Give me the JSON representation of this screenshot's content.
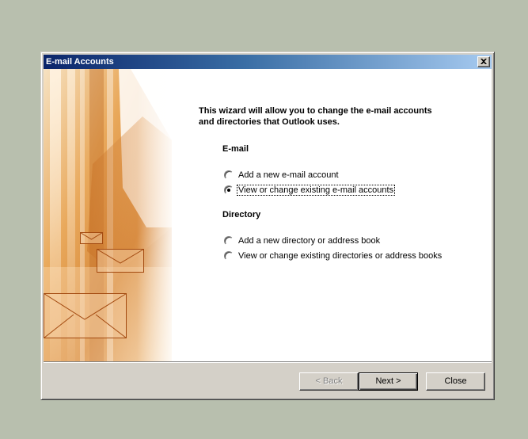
{
  "window": {
    "title": "E-mail Accounts",
    "close_glyph": "×"
  },
  "intro": {
    "text": "This wizard will allow you to change the e-mail accounts and directories that Outlook uses."
  },
  "email_section": {
    "label": "E-mail",
    "options": [
      {
        "label": "Add a new e-mail account",
        "checked": false
      },
      {
        "label": "View or change existing e-mail accounts",
        "checked": true
      }
    ]
  },
  "directory_section": {
    "label": "Directory",
    "options": [
      {
        "label": "Add a new directory or address book",
        "checked": false
      },
      {
        "label": "View or change existing directories or address books",
        "checked": false
      }
    ]
  },
  "buttons": {
    "back": "< Back",
    "next": "Next >",
    "close": "Close"
  },
  "colors": {
    "desktop": "#b8bfae",
    "title_active_start": "#0a246a",
    "title_active_end": "#a6caf0",
    "face": "#d4d0c8",
    "art_orange": "#d98a3a"
  },
  "icons": {
    "close": "close-icon",
    "decoration": "envelope-icon"
  }
}
